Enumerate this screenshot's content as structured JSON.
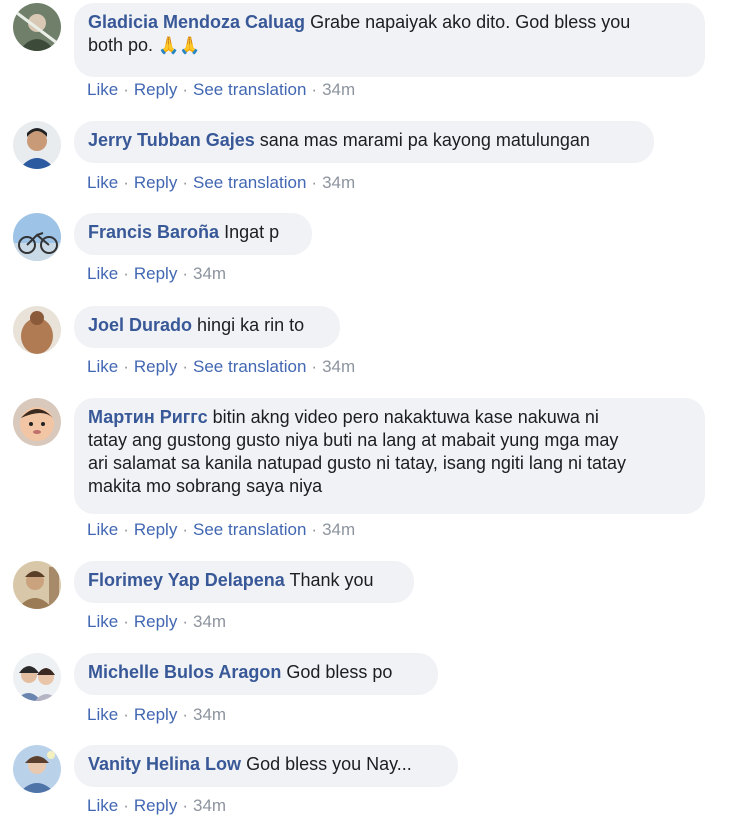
{
  "comments": [
    {
      "author": "Gladicia Mendoza Caluag",
      "text": "Grabe napaiyak ako dito. God bless you",
      "text2": "both po.",
      "emoji": "🙏🙏",
      "like": "Like",
      "reply": "Reply",
      "translate": "See translation",
      "time": "34m"
    },
    {
      "author": "Jerry Tubban Gajes",
      "text": "sana mas marami pa kayong matulungan",
      "like": "Like",
      "reply": "Reply",
      "translate": "See translation",
      "time": "34m"
    },
    {
      "author": "Francis Baroña",
      "text": "Ingat p",
      "like": "Like",
      "reply": "Reply",
      "time": "34m"
    },
    {
      "author": "Joel Durado",
      "text": "hingi ka rin to",
      "like": "Like",
      "reply": "Reply",
      "translate": "See translation",
      "time": "34m"
    },
    {
      "author": "Мартин Риггс",
      "text": "bitin akng video pero nakaktuwa kase nakuwa ni",
      "text2": "tatay ang gustong gusto niya buti na lang at mabait yung mga may",
      "text3": "ari salamat sa kanila natupad gusto ni tatay, isang ngiti lang ni tatay",
      "text4": "makita mo sobrang saya niya",
      "like": "Like",
      "reply": "Reply",
      "translate": "See translation",
      "time": "34m"
    },
    {
      "author": "Florimey Yap Delapena",
      "text": "Thank you",
      "like": "Like",
      "reply": "Reply",
      "time": "34m"
    },
    {
      "author": "Michelle Bulos Aragon",
      "text": "God bless po",
      "like": "Like",
      "reply": "Reply",
      "time": "34m"
    },
    {
      "author": "Vanity Helina Low",
      "text": "God bless you Nay...",
      "like": "Like",
      "reply": "Reply",
      "time": "34m"
    }
  ],
  "colors": {
    "author": "#385898",
    "action_link": "#4267b2",
    "timestamp": "#8d949e",
    "bubble": "#f0f2f5"
  },
  "icons": [
    "folded-hands-emoji",
    "avatar-photo"
  ]
}
